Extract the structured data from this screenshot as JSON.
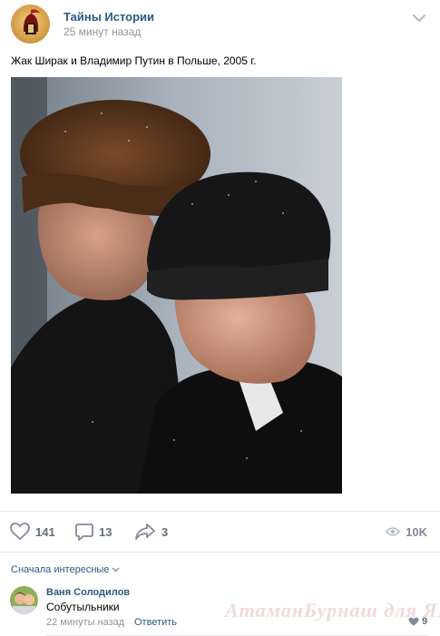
{
  "post": {
    "group_name": "Тайны Истории",
    "time": "25 минут назад",
    "text": "Жак Ширак и Владимир Путин в Польше, 2005 г."
  },
  "actions": {
    "likes": "141",
    "comments": "13",
    "shares": "3",
    "views": "10K"
  },
  "comments_section": {
    "sort_label": "Сначала интересные"
  },
  "comment": {
    "author": "Ваня Солодилов",
    "text": "Собутыльники",
    "time": "22 минуты назад",
    "reply_label": "Ответить",
    "likes": "9"
  },
  "watermark": "АтаманБурнаш для ЯП",
  "colors": {
    "link": "#2a5885",
    "muted": "#939393",
    "icon": "#828a99",
    "divider": "#e7e8ec"
  }
}
